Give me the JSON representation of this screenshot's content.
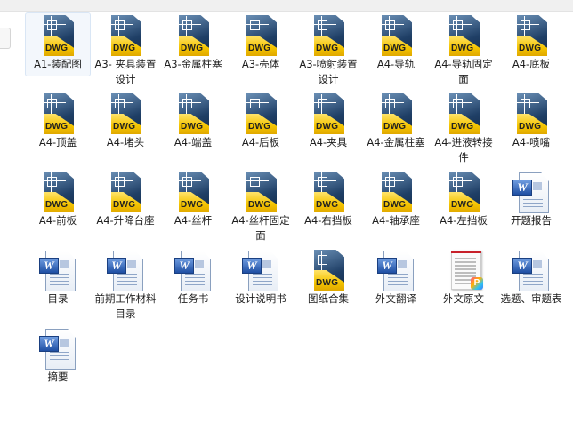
{
  "files": [
    {
      "name": "A1-装配图",
      "type": "dwg",
      "icon": "dwg-file-icon",
      "badge": "DWG",
      "selected": true
    },
    {
      "name": "A3- 夹具装置设计",
      "type": "dwg",
      "icon": "dwg-file-icon",
      "badge": "DWG"
    },
    {
      "name": "A3-金属柱塞",
      "type": "dwg",
      "icon": "dwg-file-icon",
      "badge": "DWG"
    },
    {
      "name": "A3-壳体",
      "type": "dwg",
      "icon": "dwg-file-icon",
      "badge": "DWG"
    },
    {
      "name": "A3-喷射装置设计",
      "type": "dwg",
      "icon": "dwg-file-icon",
      "badge": "DWG"
    },
    {
      "name": "A4-导轨",
      "type": "dwg",
      "icon": "dwg-file-icon",
      "badge": "DWG"
    },
    {
      "name": "A4-导轨固定面",
      "type": "dwg",
      "icon": "dwg-file-icon",
      "badge": "DWG"
    },
    {
      "name": "A4-底板",
      "type": "dwg",
      "icon": "dwg-file-icon",
      "badge": "DWG"
    },
    {
      "name": "A4-顶盖",
      "type": "dwg",
      "icon": "dwg-file-icon",
      "badge": "DWG"
    },
    {
      "name": "A4-堵头",
      "type": "dwg",
      "icon": "dwg-file-icon",
      "badge": "DWG"
    },
    {
      "name": "A4-端盖",
      "type": "dwg",
      "icon": "dwg-file-icon",
      "badge": "DWG"
    },
    {
      "name": "A4-后板",
      "type": "dwg",
      "icon": "dwg-file-icon",
      "badge": "DWG"
    },
    {
      "name": "A4-夹具",
      "type": "dwg",
      "icon": "dwg-file-icon",
      "badge": "DWG"
    },
    {
      "name": "A4-金属柱塞",
      "type": "dwg",
      "icon": "dwg-file-icon",
      "badge": "DWG"
    },
    {
      "name": "A4-进液转接件",
      "type": "dwg",
      "icon": "dwg-file-icon",
      "badge": "DWG"
    },
    {
      "name": "A4-喷嘴",
      "type": "dwg",
      "icon": "dwg-file-icon",
      "badge": "DWG"
    },
    {
      "name": "A4-前板",
      "type": "dwg",
      "icon": "dwg-file-icon",
      "badge": "DWG"
    },
    {
      "name": "A4-升降台座",
      "type": "dwg",
      "icon": "dwg-file-icon",
      "badge": "DWG"
    },
    {
      "name": "A4-丝杆",
      "type": "dwg",
      "icon": "dwg-file-icon",
      "badge": "DWG"
    },
    {
      "name": "A4-丝杆固定面",
      "type": "dwg",
      "icon": "dwg-file-icon",
      "badge": "DWG"
    },
    {
      "name": "A4-右挡板",
      "type": "dwg",
      "icon": "dwg-file-icon",
      "badge": "DWG"
    },
    {
      "name": "A4-轴承座",
      "type": "dwg",
      "icon": "dwg-file-icon",
      "badge": "DWG"
    },
    {
      "name": "A4-左挡板",
      "type": "dwg",
      "icon": "dwg-file-icon",
      "badge": "DWG"
    },
    {
      "name": "开题报告",
      "type": "doc",
      "icon": "word-document-icon",
      "badge": "W"
    },
    {
      "name": "目录",
      "type": "doc",
      "icon": "word-document-icon",
      "badge": "W"
    },
    {
      "name": "前期工作材料目录",
      "type": "doc",
      "icon": "word-document-icon",
      "badge": "W"
    },
    {
      "name": "任务书",
      "type": "doc",
      "icon": "word-document-icon",
      "badge": "W"
    },
    {
      "name": "设计说明书",
      "type": "doc",
      "icon": "word-document-icon",
      "badge": "W"
    },
    {
      "name": "图纸合集",
      "type": "dwg",
      "icon": "dwg-file-icon",
      "badge": "DWG"
    },
    {
      "name": "外文翻译",
      "type": "doc",
      "icon": "word-document-icon",
      "badge": "W"
    },
    {
      "name": "外文原文",
      "type": "pdf",
      "icon": "pdf-document-icon",
      "badge": "P"
    },
    {
      "name": "选题、审题表",
      "type": "doc",
      "icon": "word-document-icon",
      "badge": "W"
    },
    {
      "name": "摘要",
      "type": "doc",
      "icon": "word-document-icon",
      "badge": "W"
    }
  ]
}
